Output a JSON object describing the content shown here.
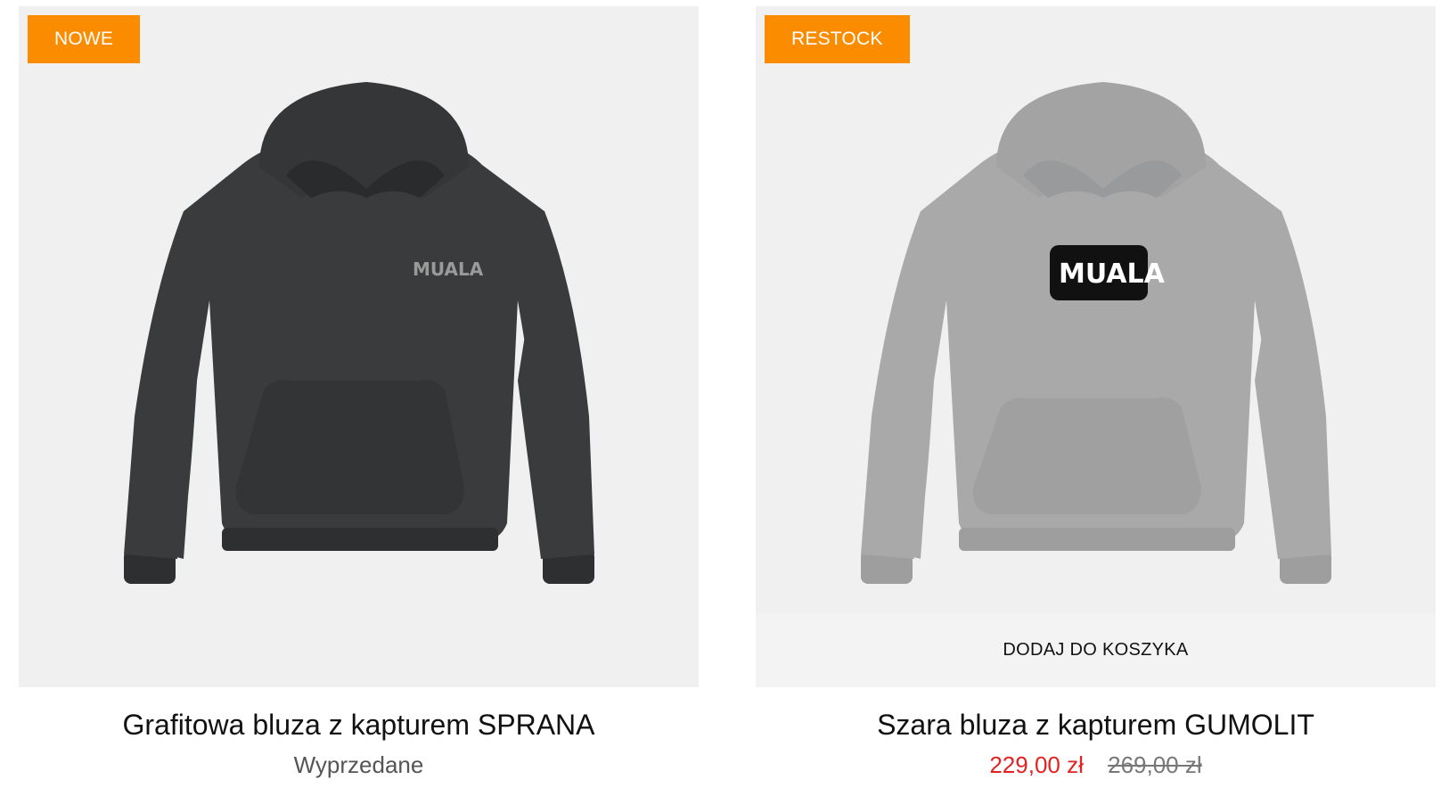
{
  "products": [
    {
      "badge": "NOWE",
      "title": "Grafitowa bluza z kapturem SPRANA",
      "status": "Wyprzedane",
      "print_text": "MUALA",
      "colors": {
        "garment": "#3a3b3d",
        "garment_dark": "#2a2b2d",
        "print": "#9a9a9a"
      }
    },
    {
      "badge": "RESTOCK",
      "title": "Szara bluza z kapturem GUMOLIT",
      "price": "229,00 zł",
      "old_price": "269,00 zł",
      "add_to_cart": "DODAJ DO KOSZYKA",
      "print_text": "MUALA",
      "colors": {
        "garment": "#a9a9aa",
        "garment_dark": "#999a9b",
        "print": "#ffffff"
      }
    }
  ],
  "colors": {
    "badge_bg": "#fb8c00",
    "sale_price": "#e32222",
    "card_bg": "#f0f0f0"
  }
}
